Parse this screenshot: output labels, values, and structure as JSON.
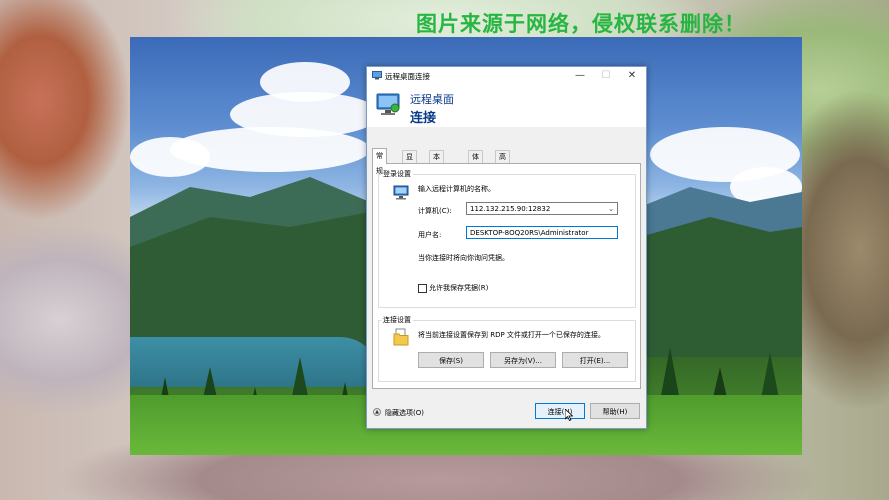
{
  "watermark": "图片来源于网络，侵权联系删除！",
  "window": {
    "title": "远程桌面连接",
    "minimize": "—",
    "maximize": "☐",
    "close": "✕"
  },
  "header": {
    "line1": "远程桌面",
    "line2": "连接"
  },
  "tabs": [
    "常规",
    "显示",
    "本地资源",
    "体验",
    "高级"
  ],
  "logon": {
    "group_label": "登录设置",
    "prompt": "输入远程计算机的名称。",
    "computer_label": "计算机(C):",
    "computer_value": "112.132.215.90:12832",
    "username_label": "用户名:",
    "username_value": "DESKTOP-8OQ20RS\\Administrator",
    "credential_note": "当你连接时将向你询问凭据。",
    "save_credentials_label": "允许我保存凭据(R)"
  },
  "connection": {
    "group_label": "连接设置",
    "description": "将当前连接设置保存到 RDP 文件或打开一个已保存的连接。",
    "save_btn": "保存(S)",
    "save_as_btn": "另存为(V)...",
    "open_btn": "打开(E)..."
  },
  "footer": {
    "hide_options": "隐藏选项(O)",
    "connect_btn": "连接(N)",
    "help_btn": "帮助(H)"
  },
  "colors": {
    "accent": "#0078d7",
    "header_text": "#0a3a8a",
    "watermark": "#1fb43c"
  }
}
